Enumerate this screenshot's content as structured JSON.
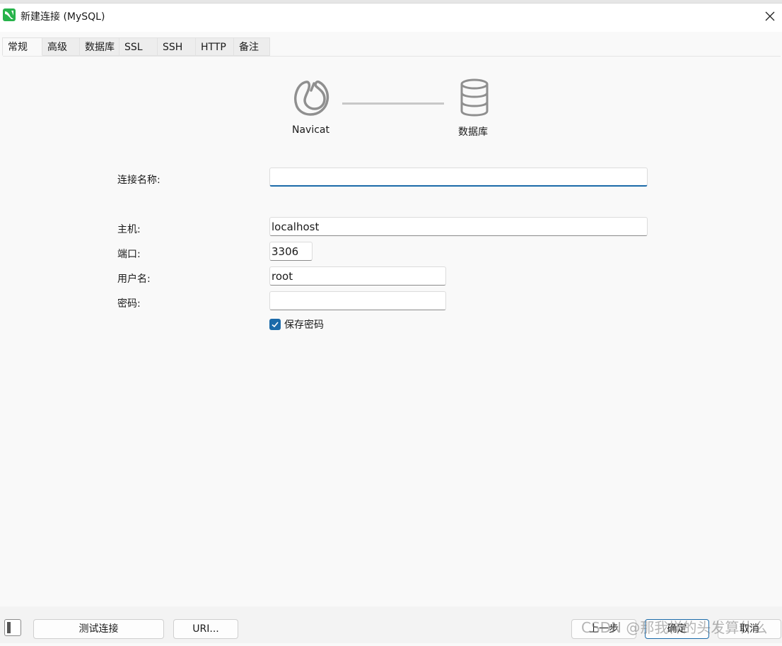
{
  "window": {
    "title": "新建连接 (MySQL)"
  },
  "tabs": [
    {
      "label": "常规",
      "active": true
    },
    {
      "label": "高级"
    },
    {
      "label": "数据库"
    },
    {
      "label": "SSL"
    },
    {
      "label": "SSH"
    },
    {
      "label": "HTTP"
    },
    {
      "label": "备注"
    }
  ],
  "diagram": {
    "left_label": "Navicat",
    "right_label": "数据库",
    "left_icon": "navicat-logo-icon",
    "right_icon": "database-icon"
  },
  "form": {
    "connection_name": {
      "label": "连接名称:",
      "value": ""
    },
    "host": {
      "label": "主机:",
      "value": "localhost"
    },
    "port": {
      "label": "端口:",
      "value": "3306"
    },
    "username": {
      "label": "用户名:",
      "value": "root"
    },
    "password": {
      "label": "密码:",
      "value": ""
    },
    "save_password": {
      "label": "保存密码",
      "checked": true
    }
  },
  "footer": {
    "test_button": "测试连接",
    "uri_button": "URI...",
    "prev_button": "上一步",
    "ok_button": "确定",
    "cancel_button": "取消"
  },
  "watermark": "CSDN @那我样的头发算什么",
  "colors": {
    "accent": "#1b6aa9",
    "app_logo": "#27b34b"
  }
}
